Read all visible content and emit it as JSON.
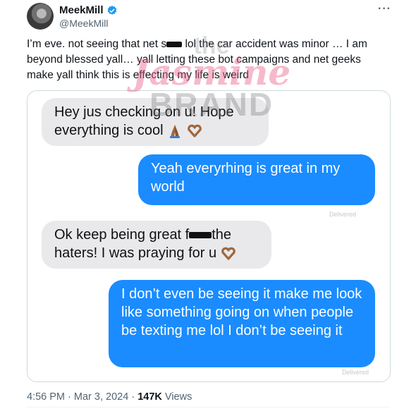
{
  "header": {
    "display_name": "MeekMill",
    "handle": "@MeekMill",
    "more_label": "···"
  },
  "tweet": {
    "text_part1": "I’m  eve. not seeing that net s",
    "text_part2": " lol the car accident was minor … I am beyond blessed yall… yall letting these bot campaigns and net geeks make yall think this is effecting my life is weird"
  },
  "messages": [
    {
      "type": "received",
      "text": "Hey jus checking on u! Hope everything is cool"
    },
    {
      "type": "sent",
      "text": "Yeah everyrhing is great in my world"
    },
    {
      "type": "received",
      "text_part1": "Ok keep being great f",
      "text_part2": "the haters! I was praying for u"
    },
    {
      "type": "sent",
      "text": "I don’t even be seeing it make me look like something going on when people be texting me lol I don’t be seeing it"
    }
  ],
  "delivered_label": "Delivered",
  "watermark": {
    "line1": "the",
    "line2": "Jasmine",
    "line3": "BRAND"
  },
  "meta": {
    "time": "4:56 PM",
    "separator": "·",
    "date": "Mar 3, 2024",
    "views_count": "147K",
    "views_label": "Views"
  },
  "colors": {
    "sent_bubble": "#1a8cff",
    "received_bubble": "#e9e9eb",
    "verified": "#1d9bf0"
  },
  "icons": [
    "verified-badge-icon",
    "more-options-icon",
    "praying-hands-emoji",
    "heart-hands-emoji"
  ]
}
